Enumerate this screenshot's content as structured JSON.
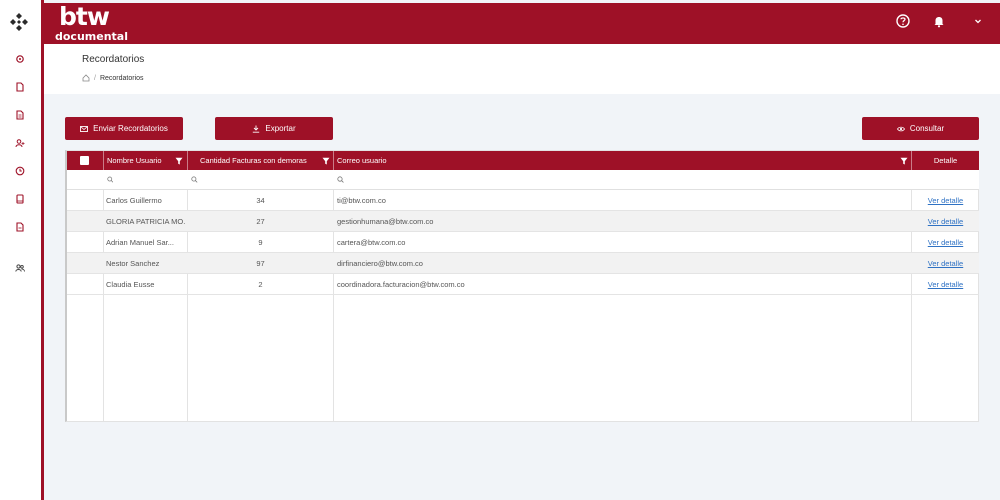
{
  "brand": {
    "name": "btw",
    "subtitle": "documental"
  },
  "sidebar": {
    "items": [
      {
        "icon": "settings-icon"
      },
      {
        "icon": "document-icon"
      },
      {
        "icon": "document-alt-icon"
      },
      {
        "icon": "user-icon"
      },
      {
        "icon": "clock-icon"
      },
      {
        "icon": "book-icon"
      },
      {
        "icon": "file-icon"
      },
      {
        "icon": "users-icon"
      }
    ]
  },
  "topbar": {
    "icons": [
      "help-icon",
      "bell-icon",
      "chevron-down-icon"
    ]
  },
  "page": {
    "title": "Recordatorios",
    "breadcrumb": {
      "separator": "/",
      "current": "Recordatorios"
    }
  },
  "actions": {
    "send": "Enviar Recordatorios",
    "export": "Exportar",
    "query": "Consultar"
  },
  "table": {
    "columns": {
      "user": "Nombre Usuario",
      "count": "Cantidad Facturas con demoras",
      "email": "Correo usuario",
      "detail": "Detalle"
    },
    "rows": [
      {
        "user": "Carlos Guillermo",
        "count": "34",
        "email": "ti@btw.com.co",
        "detail": "Ver detalle"
      },
      {
        "user": "GLORIA PATRICIA MO...",
        "count": "27",
        "email": "gestionhumana@btw.com.co",
        "detail": "Ver detalle"
      },
      {
        "user": "Adrian Manuel Sar...",
        "count": "9",
        "email": "cartera@btw.com.co",
        "detail": "Ver detalle"
      },
      {
        "user": "Nestor Sanchez",
        "count": "97",
        "email": "dirfinanciero@btw.com.co",
        "detail": "Ver detalle"
      },
      {
        "user": "Claudia Eusse",
        "count": "2",
        "email": "coordinadora.facturacion@btw.com.co",
        "detail": "Ver detalle"
      }
    ]
  },
  "colors": {
    "brand": "#9e1127",
    "link": "#2f72c4"
  }
}
